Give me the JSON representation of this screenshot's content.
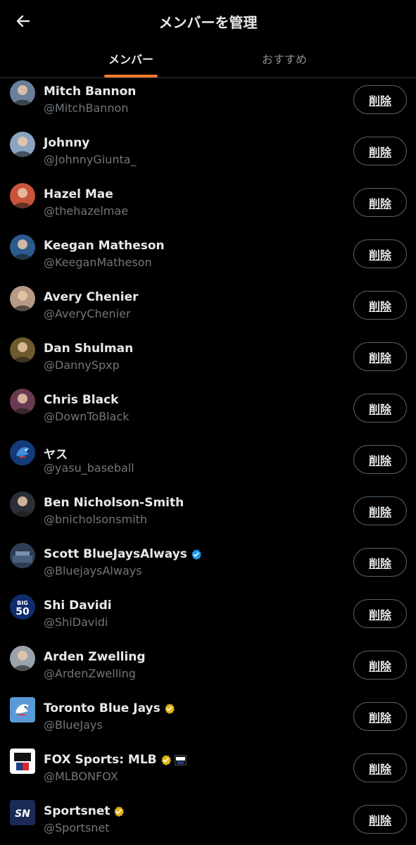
{
  "header": {
    "title": "メンバーを管理",
    "back_icon": "arrow-left-icon"
  },
  "tabs": [
    {
      "label": "メンバー",
      "active": true
    },
    {
      "label": "おすすめ",
      "active": false
    }
  ],
  "colors": {
    "accent": "#f07a2b",
    "verified_blue": "#1d9bf0",
    "verified_gold": "#e2b719",
    "handle": "#71767b"
  },
  "members": [
    {
      "name": "Mitch Bannon",
      "handle": "@MitchBannon",
      "badge": null,
      "avatar_color": "#6a7f9a",
      "remove_label": "削除"
    },
    {
      "name": "Johnny",
      "handle": "@JohnnyGiunta_",
      "badge": null,
      "avatar_color": "#8aa4c2",
      "remove_label": "削除"
    },
    {
      "name": "Hazel Mae",
      "handle": "@thehazelmae",
      "badge": null,
      "avatar_color": "#c8553a",
      "remove_label": "削除"
    },
    {
      "name": "Keegan Matheson",
      "handle": "@KeeganMatheson",
      "badge": null,
      "avatar_color": "#2c5a8c",
      "remove_label": "削除"
    },
    {
      "name": "Avery Chenier",
      "handle": "@AveryChenier",
      "badge": null,
      "avatar_color": "#b59a86",
      "remove_label": "削除"
    },
    {
      "name": "Dan Shulman",
      "handle": "@DannySpxp",
      "badge": null,
      "avatar_color": "#6d5a2e",
      "remove_label": "削除"
    },
    {
      "name": "Chris Black",
      "handle": "@DownToBlack",
      "badge": null,
      "avatar_color": "#6b3a52",
      "remove_label": "削除"
    },
    {
      "name": "ヤス",
      "handle": "@yasu_baseball",
      "badge": null,
      "avatar_color": "#163a78",
      "remove_label": "削除"
    },
    {
      "name": "Ben Nicholson-Smith",
      "handle": "@bnicholsonsmith",
      "badge": null,
      "avatar_color": "#2b2f36",
      "remove_label": "削除"
    },
    {
      "name": "Scott BlueJaysAlways",
      "handle": "@BluejaysAlways",
      "badge": "blue",
      "avatar_color": "#2e3d55",
      "remove_label": "削除"
    },
    {
      "name": "Shi Davidi",
      "handle": "@ShiDavidi",
      "badge": null,
      "avatar_color": "#0e2c6e",
      "remove_label": "削除"
    },
    {
      "name": "Arden Zwelling",
      "handle": "@ArdenZwelling",
      "badge": null,
      "avatar_color": "#9aa3ab",
      "remove_label": "削除"
    },
    {
      "name": "Toronto Blue Jays",
      "handle": "@BlueJays",
      "badge": "gold",
      "avatar_color": "#5b9ad6",
      "remove_label": "削除"
    },
    {
      "name": "FOX Sports: MLB",
      "handle": "@MLBONFOX",
      "badge": "gold-fox",
      "avatar_color": "#ffffff",
      "remove_label": "削除"
    },
    {
      "name": "Sportsnet",
      "handle": "@Sportsnet",
      "badge": "gold",
      "avatar_color": "#1b2a55",
      "remove_label": "削除"
    }
  ]
}
